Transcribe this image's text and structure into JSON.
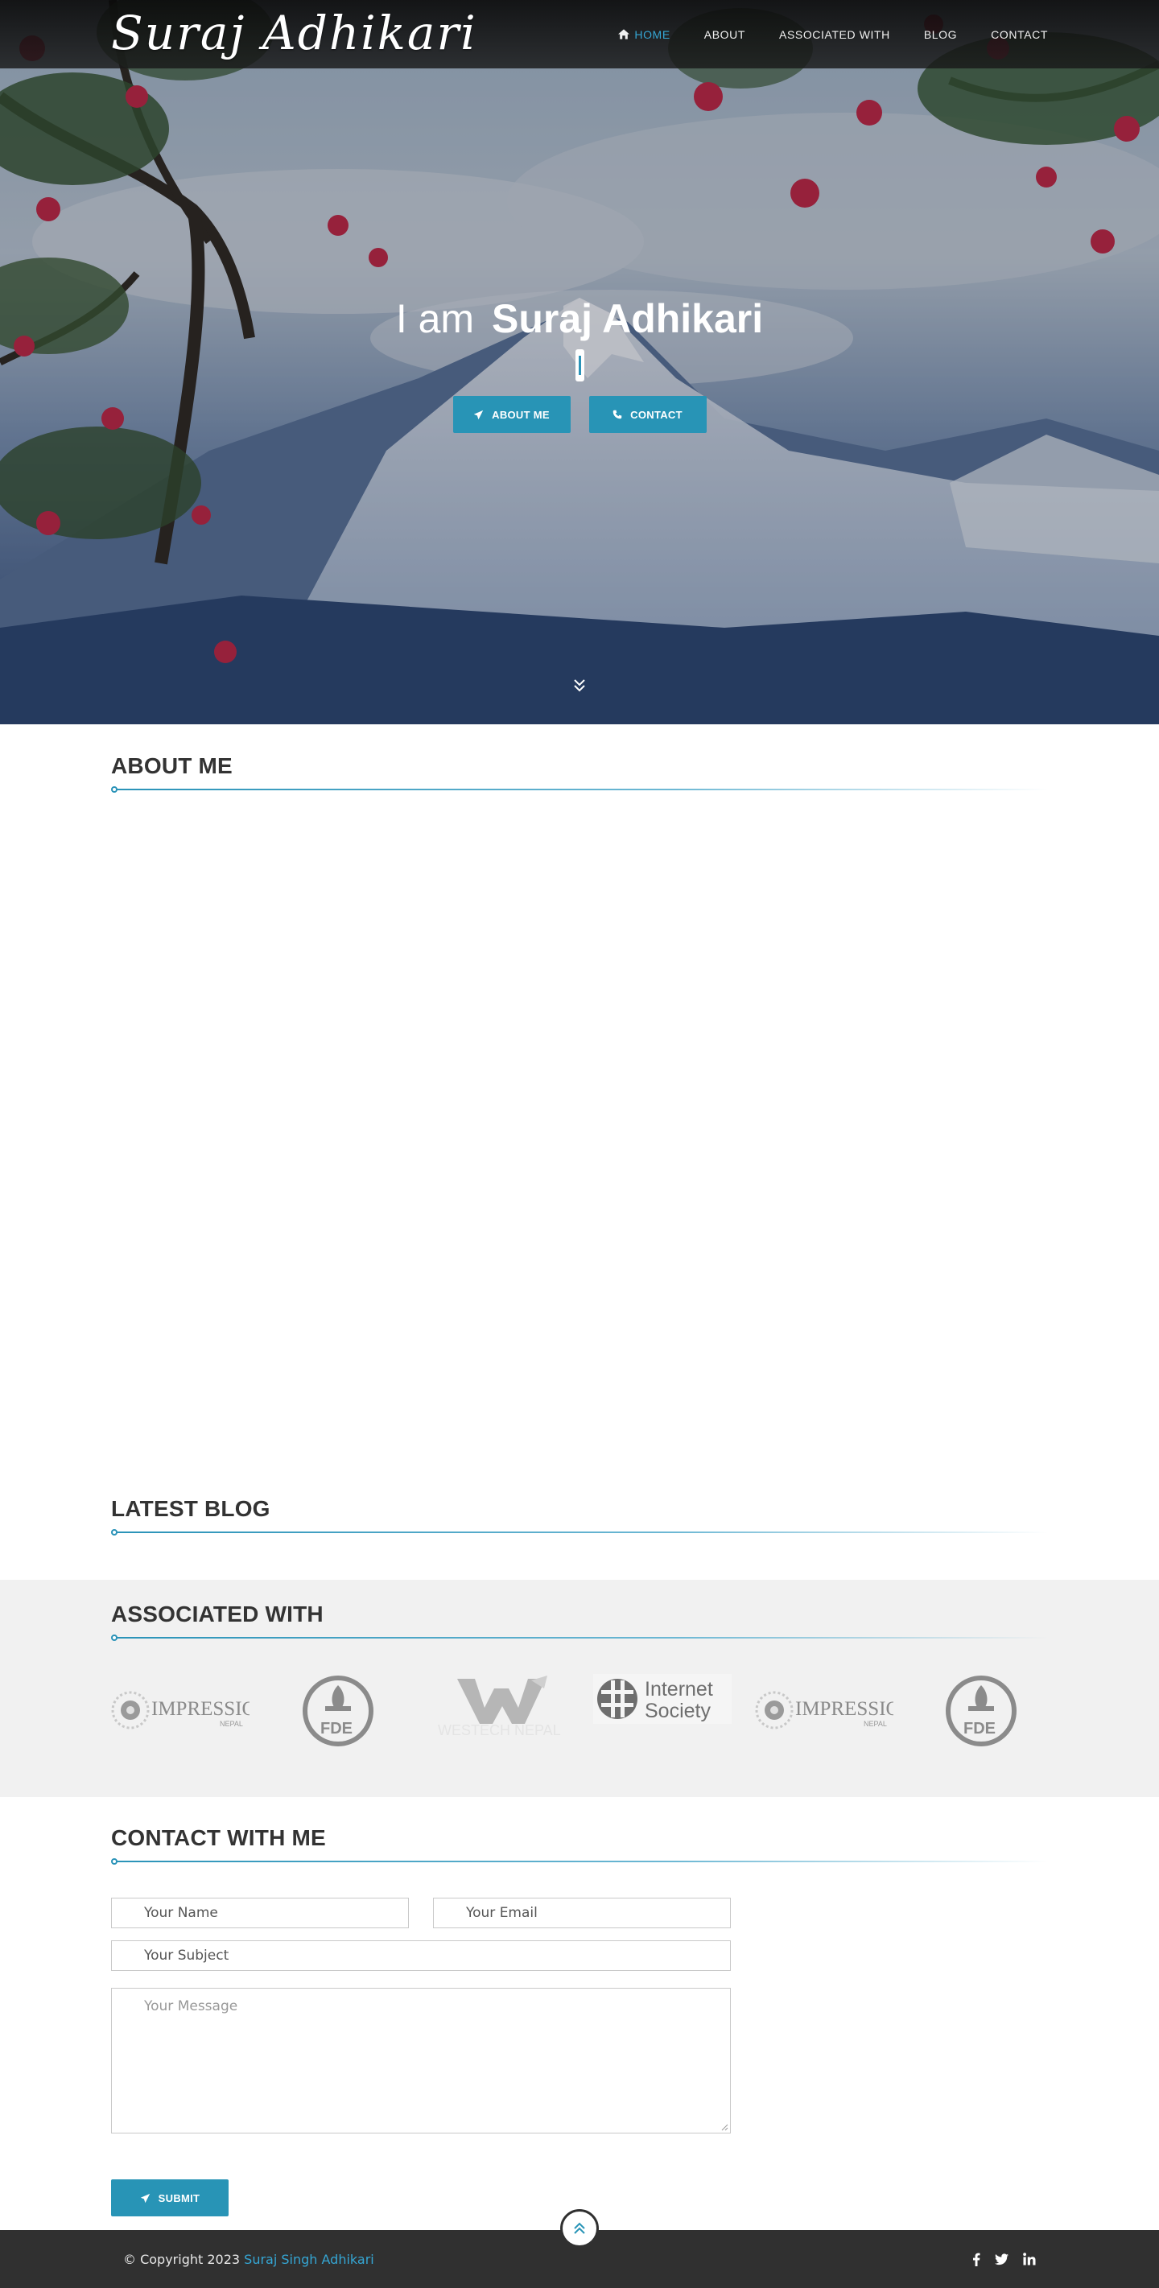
{
  "site": {
    "brand": "Suraj Adhikari"
  },
  "nav": {
    "items": [
      {
        "label": "HOME",
        "active": true
      },
      {
        "label": "ABOUT",
        "active": false
      },
      {
        "label": "ASSOCIATED WITH",
        "active": false
      },
      {
        "label": "BLOG",
        "active": false
      },
      {
        "label": "CONTACT",
        "active": false
      }
    ]
  },
  "hero": {
    "prefix": "I am",
    "name": "Suraj Adhikari",
    "buttons": [
      {
        "label": "ABOUT ME",
        "icon": "paper-plane-icon"
      },
      {
        "label": "CONTACT",
        "icon": "phone-icon"
      }
    ],
    "scroll_icon": "double-chevron-down-icon"
  },
  "sections": {
    "about_title": "ABOUT ME",
    "blog_title": "LATEST BLOG",
    "associated_title": "ASSOCIATED WITH",
    "contact_title": "CONTACT WITH ME"
  },
  "associated": {
    "logos": [
      {
        "name": "IMPRESSION",
        "sub": "NEPAL"
      },
      {
        "name": "FDE"
      },
      {
        "name": "WESTECH NEPAL"
      },
      {
        "name": "Internet",
        "sub": "Society"
      },
      {
        "name": "IMPRESSION",
        "sub": "NEPAL"
      },
      {
        "name": "FDE"
      }
    ]
  },
  "contact": {
    "name_placeholder": "Your Name",
    "email_placeholder": "Your Email",
    "subject_placeholder": "Your Subject",
    "message_placeholder": "Your Message",
    "submit_label": "SUBMIT"
  },
  "footer": {
    "copyright": "© Copyright 2023",
    "author": "Suraj Singh Adhikari",
    "social": [
      "facebook-icon",
      "twitter-icon",
      "linkedin-icon"
    ]
  },
  "colors": {
    "accent": "#2894b6",
    "link": "#35a6d4",
    "footer_bg": "#303030",
    "associated_bg": "#f1f1f1"
  }
}
